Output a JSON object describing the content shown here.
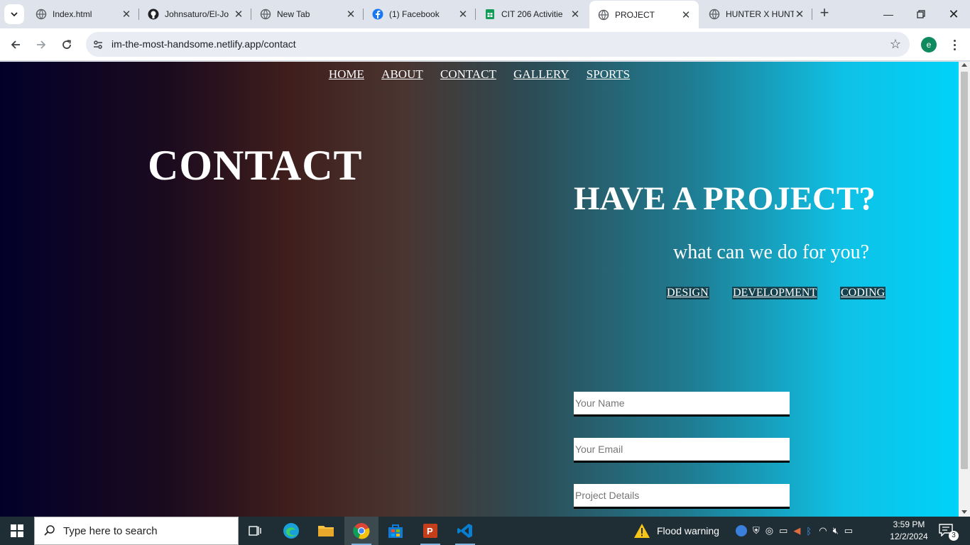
{
  "browser": {
    "tabs": [
      {
        "title": "Index.html",
        "icon": "globe-icon"
      },
      {
        "title": "Johnsaturo/El-Jo",
        "icon": "github-icon"
      },
      {
        "title": "New Tab",
        "icon": "globe-icon"
      },
      {
        "title": "(1) Facebook",
        "icon": "facebook-icon"
      },
      {
        "title": "CIT 206 Activitie",
        "icon": "sheets-icon"
      },
      {
        "title": "PROJECT",
        "icon": "globe-icon",
        "active": true
      },
      {
        "title": "HUNTER X HUNT",
        "icon": "globe-icon"
      }
    ],
    "url": "im-the-most-handsome.netlify.app/contact",
    "profile_initial": "e"
  },
  "site": {
    "nav": [
      "HOME",
      "ABOUT",
      "CONTACT",
      "GALLERY",
      "SPORTS"
    ],
    "contact_title": "CONTACT",
    "project_title": "HAVE A PROJECT?",
    "project_subtitle": "what can we do for you?",
    "services": [
      "DESIGN",
      "DEVELOPMENT",
      "CODING"
    ],
    "form": {
      "name_placeholder": "Your Name",
      "email_placeholder": "Your Email",
      "details_placeholder": "Project Details"
    }
  },
  "taskbar": {
    "search_placeholder": "Type here to search",
    "weather": "Flood warning",
    "time": "3:59 PM",
    "date": "12/2/2024",
    "notification_count": "3"
  },
  "colors": {
    "gradient": [
      "#02002a",
      "#3f1e1c",
      "#2d4b54",
      "#00d2f8"
    ],
    "service_highlight": "#14434f"
  }
}
